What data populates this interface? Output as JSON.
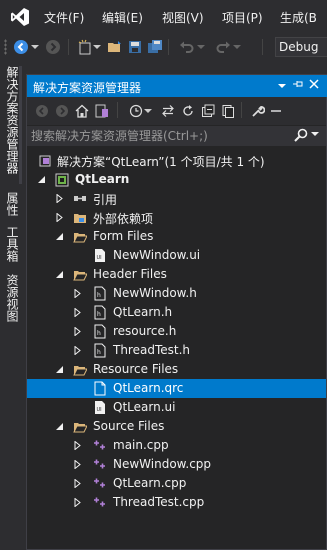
{
  "menu": {
    "file": "文件(F)",
    "edit": "编辑(E)",
    "view": "视图(V)",
    "project": "项目(P)",
    "build": "生成(B"
  },
  "toolbar": {
    "configuration": "Debug"
  },
  "side_tabs": {
    "solution_explorer": "解决方案资源管理器",
    "properties": "属性",
    "toolbox": "工具箱",
    "resource_view": "资源视图"
  },
  "panel": {
    "title": "解决方案资源管理器",
    "search_placeholder": "搜索解决方案资源管理器(Ctrl+;)"
  },
  "tree": [
    {
      "label": "解决方案“QtLearn”(1 个项目/共 1 个)",
      "icon": "solution-icon"
    },
    {
      "label": "QtLearn",
      "icon": "project-icon"
    },
    {
      "label": "引用",
      "icon": "references-icon"
    },
    {
      "label": "外部依赖项",
      "icon": "external-deps-icon"
    },
    {
      "label": "Form Files",
      "icon": "folder-icon"
    },
    {
      "label": "NewWindow.ui",
      "icon": "ui-file-icon"
    },
    {
      "label": "Header Files",
      "icon": "folder-icon"
    },
    {
      "label": "NewWindow.h",
      "icon": "header-file-icon"
    },
    {
      "label": "QtLearn.h",
      "icon": "header-file-icon"
    },
    {
      "label": "resource.h",
      "icon": "header-file-icon"
    },
    {
      "label": "ThreadTest.h",
      "icon": "header-file-icon"
    },
    {
      "label": "Resource Files",
      "icon": "folder-icon"
    },
    {
      "label": "QtLearn.qrc",
      "icon": "resource-file-icon"
    },
    {
      "label": "QtLearn.ui",
      "icon": "ui-file-icon"
    },
    {
      "label": "Source Files",
      "icon": "folder-icon"
    },
    {
      "label": "main.cpp",
      "icon": "cpp-file-icon"
    },
    {
      "label": "NewWindow.cpp",
      "icon": "cpp-file-icon"
    },
    {
      "label": "QtLearn.cpp",
      "icon": "cpp-file-icon"
    },
    {
      "label": "ThreadTest.cpp",
      "icon": "cpp-file-icon"
    }
  ],
  "colors": {
    "accent": "#007acc",
    "background": "#2d2d30",
    "panel_background": "#252526",
    "cpp_icon": "#b180d7"
  }
}
